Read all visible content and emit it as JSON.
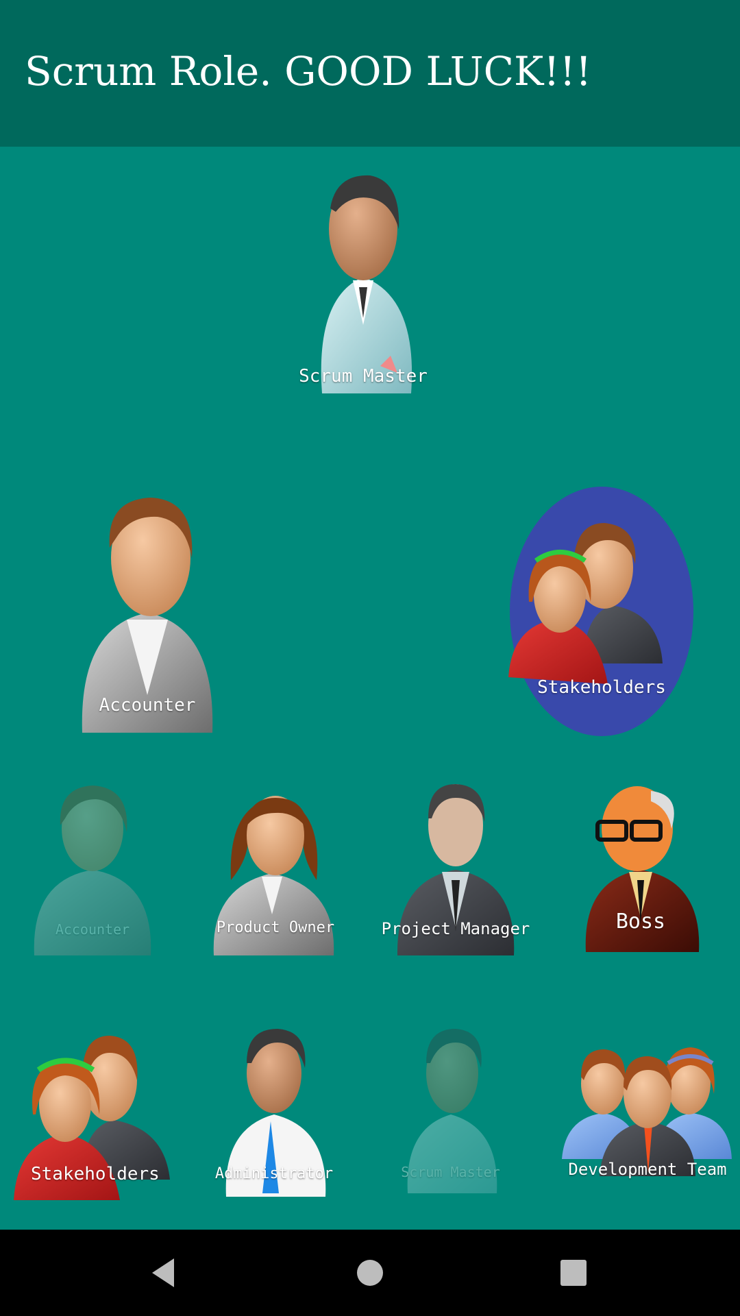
{
  "app_bar": {
    "title": "Scrum Role. GOOD LUCK!!!"
  },
  "targets": {
    "top": {
      "label": "Scrum Master"
    },
    "left": {
      "label": "Accounter"
    },
    "right": {
      "label": "Stakeholders",
      "highlight_color": "#3949ab"
    }
  },
  "roles": [
    {
      "label": "Accounter",
      "faded": true
    },
    {
      "label": "Product Owner",
      "faded": false
    },
    {
      "label": "Project Manager",
      "faded": false
    },
    {
      "label": "Boss",
      "faded": false
    },
    {
      "label": "Stakeholders",
      "faded": false
    },
    {
      "label": "Administrator",
      "faded": false
    },
    {
      "label": "Scrum Master",
      "faded": true
    },
    {
      "label": "Development Team",
      "faded": false
    }
  ],
  "nav": {
    "back_icon": "back-triangle-icon",
    "home_icon": "home-circle-icon",
    "recents_icon": "recents-square-icon"
  },
  "colors": {
    "background": "#00897b",
    "app_bar": "#00695c",
    "nav_bar": "#000000"
  }
}
